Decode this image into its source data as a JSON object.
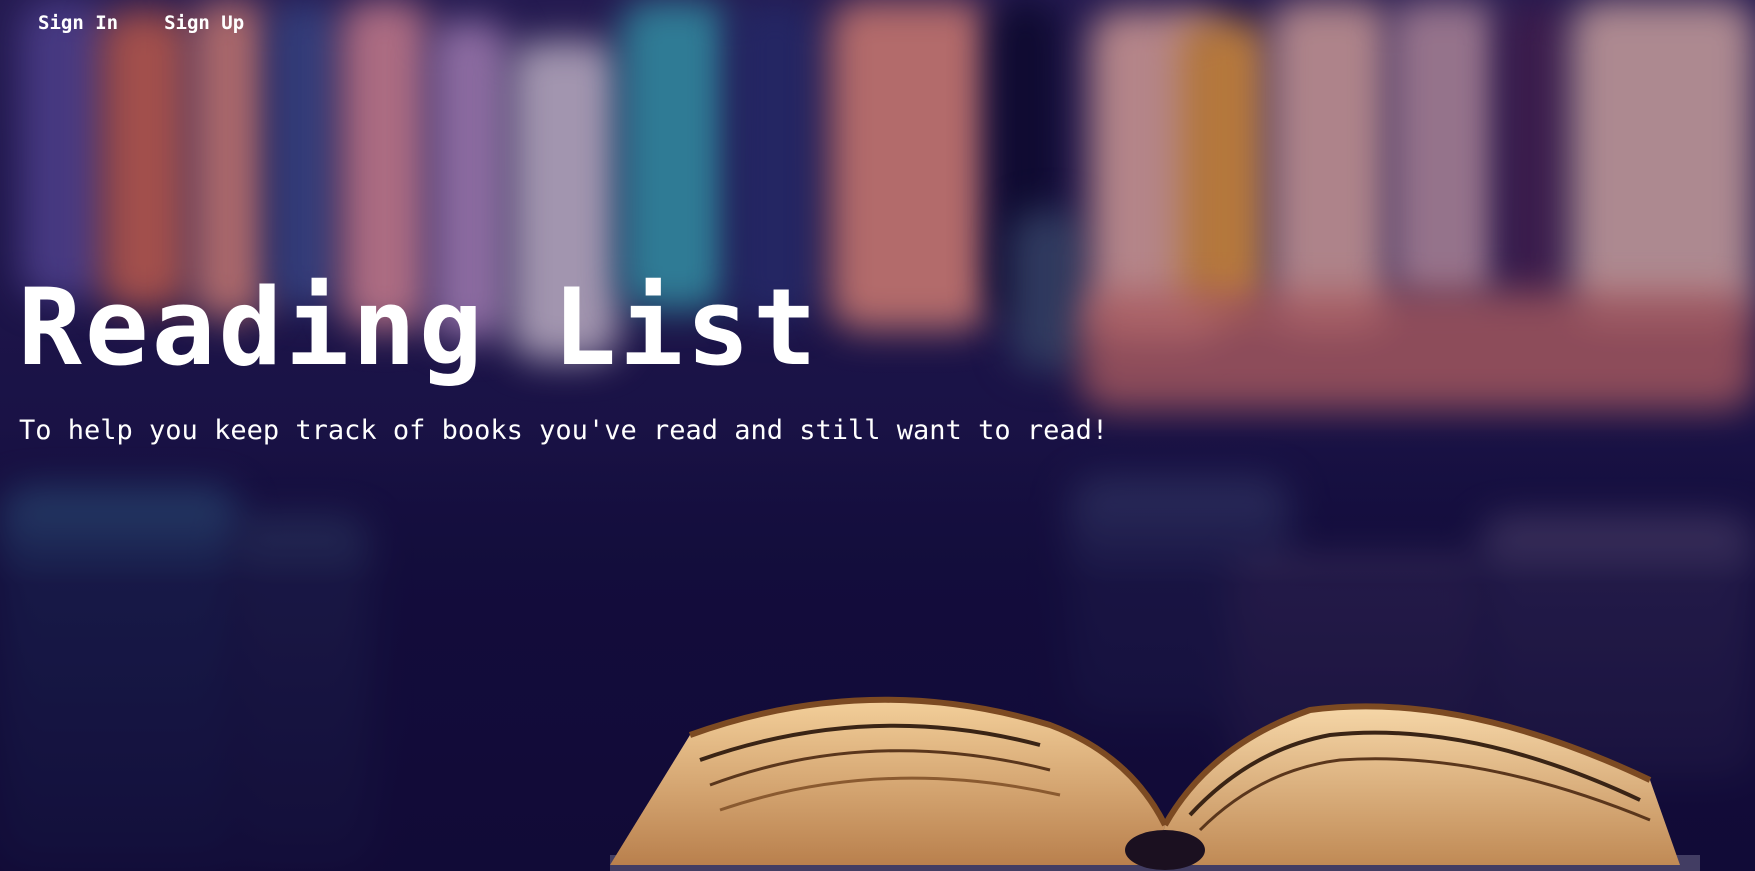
{
  "nav": {
    "sign_in": "Sign In",
    "sign_up": "Sign Up"
  },
  "hero": {
    "title": "Reading List",
    "subtitle": "To help you keep track of books you've read and still want to read!"
  },
  "background": {
    "description_icon": "blurred-bookshelf-open-book-photo",
    "tint": "#1b1450"
  }
}
